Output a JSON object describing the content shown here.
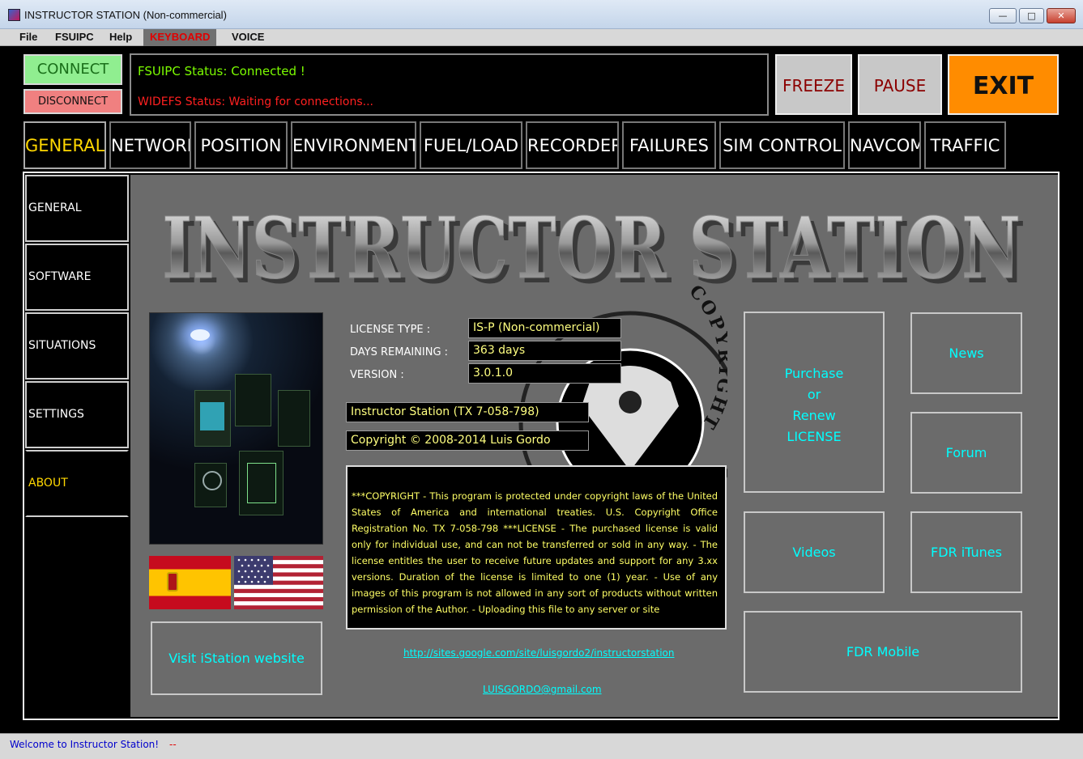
{
  "window": {
    "title": "INSTRUCTOR STATION (Non-commercial)",
    "minimize": "—",
    "maximize": "□",
    "close": "✕"
  },
  "menu": {
    "file": "File",
    "fsuipc": "FSUIPC",
    "help": "Help",
    "keyboard": "KEYBOARD",
    "voice": "VOICE"
  },
  "connect": {
    "connect_label": "CONNECT",
    "disconnect_label": "DISCONNECT"
  },
  "status": {
    "fsuipc": "FSUIPC Status: Connected !",
    "widefs": "WIDEFS Status: Waiting for connections..."
  },
  "controls": {
    "freeze": "FREEZE",
    "pause": "PAUSE",
    "exit": "EXIT"
  },
  "tabs": [
    {
      "label": "GENERAL"
    },
    {
      "label": "NETWORK"
    },
    {
      "label": "POSITION"
    },
    {
      "label": "ENVIRONMENT"
    },
    {
      "label": "FUEL/LOAD"
    },
    {
      "label": "RECORDER"
    },
    {
      "label": "FAILURES"
    },
    {
      "label": "SIM CONTROL"
    },
    {
      "label": "NAVCOM"
    },
    {
      "label": "TRAFFIC"
    }
  ],
  "sidebar": [
    {
      "label": "GENERAL"
    },
    {
      "label": "SOFTWARE"
    },
    {
      "label": "SITUATIONS"
    },
    {
      "label": "SETTINGS"
    },
    {
      "label": "ABOUT"
    }
  ],
  "about": {
    "logo_text": "INSTRUCTOR STATION",
    "seal_text": "STATES · COPYRIGHT",
    "license_type_label": "LICENSE TYPE :",
    "license_type_value": "IS-P (Non-commercial)",
    "days_remaining_label": "DAYS REMAINING :",
    "days_remaining_value": "363 days",
    "version_label": "VERSION :",
    "version_value": "3.0.1.0",
    "registration": "Instructor Station (TX 7-058-798)",
    "copyright": "Copyright © 2008-2014 Luis Gordo",
    "copyright_notice": "***COPYRIGHT - This program is protected under copyright laws of the United States of America and international treaties. U.S. Copyright Office Registration No. TX 7-058-798 ***LICENSE - The purchased license is valid only for individual use, and can not be transferred or sold in any way. - The license entitles the user to receive future updates and support for any 3.xx versions. Duration of the license is limited to one (1) year. - Use of any images of this program is not allowed in any sort of products without written permission of the Author. - Uploading this file to any server or site",
    "website_link": "http://sites.google.com/site/luisgordo2/instructorstation",
    "email_link": "LUISGORDO@gmail.com",
    "visit_button": "Visit iStation website",
    "purchase_line1": "Purchase",
    "purchase_line2": "or",
    "purchase_line3": "Renew",
    "purchase_line4": "LICENSE",
    "news": "News",
    "forum": "Forum",
    "videos": "Videos",
    "fdr_itunes": "FDR iTunes",
    "fdr_mobile": "FDR Mobile"
  },
  "statusbar": {
    "welcome": "Welcome to Instructor Station!",
    "dash": "--"
  },
  "colors": {
    "accent_yellow": "#ffd700",
    "cyan": "#00ffff",
    "exit_orange": "#ff8c00",
    "connect_green": "#90ee90",
    "disconnect_red": "#f08080"
  }
}
